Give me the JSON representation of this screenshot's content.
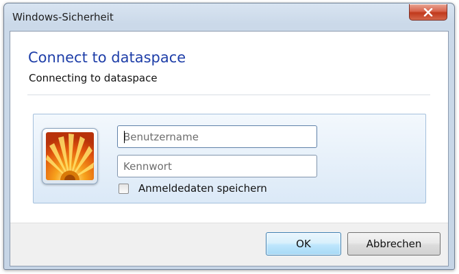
{
  "window": {
    "title": "Windows-Sicherheit"
  },
  "header": {
    "title": "Connect to dataspace",
    "subtitle": "Connecting to dataspace"
  },
  "credentials": {
    "username_placeholder": "Benutzername",
    "username_value": "",
    "password_placeholder": "Kennwort",
    "password_value": "",
    "remember_label": "Anmeldedaten speichern",
    "remember_checked": false
  },
  "buttons": {
    "ok_label": "OK",
    "cancel_label": "Abbrechen"
  },
  "icons": {
    "close": "close-icon",
    "avatar": "user-tile-flower-icon"
  },
  "colors": {
    "heading": "#1e3ea8",
    "close_button": "#c1391c",
    "default_button_border": "#3c7fb1"
  }
}
